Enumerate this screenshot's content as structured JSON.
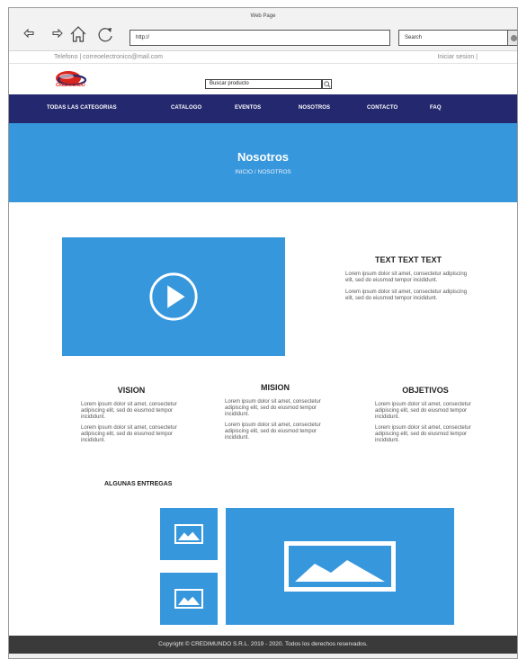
{
  "browser": {
    "window_title": "Web Page",
    "address": "http://",
    "search_placeholder": "Search"
  },
  "topbar": {
    "contact": "Telefono | correoelectronico@mail.com",
    "login": "Iniciar sesion |"
  },
  "logo": {
    "text": "CREDIMUNDO"
  },
  "product_search": {
    "placeholder": "Buscar producto"
  },
  "nav": {
    "items": [
      {
        "label": "TODAS LAS CATEGORIAS"
      },
      {
        "label": "CATALOGO"
      },
      {
        "label": "EVENTOS"
      },
      {
        "label": "NOSOTROS"
      },
      {
        "label": "CONTACTO"
      },
      {
        "label": "FAQ"
      }
    ]
  },
  "hero": {
    "title": "Nosotros",
    "breadcrumb": "INICIO / NOSOTROS"
  },
  "intro": {
    "heading": "TEXT TEXT TEXT",
    "paragraphs": [
      "Lorem ipsum dolor sit amet, consectetur adipiscing elit, sed do eiusmod tempor incididunt.",
      "Lorem ipsum dolor sit amet, consectetur adipiscing elit, sed do eiusmod tempor incididunt."
    ]
  },
  "columns": [
    {
      "title": "VISION",
      "paragraphs": [
        "Lorem ipsum dolor sit amet, consectetur adipiscing elit, sed do eiusmod tempor incididunt.",
        "Lorem ipsum dolor sit amet, consectetur adipiscing elit, sed do eiusmod tempor incididunt."
      ]
    },
    {
      "title": "MISION",
      "paragraphs": [
        "Lorem ipsum dolor sit amet, consectetur adipiscing elit, sed do eiusmod tempor incididunt.",
        "Lorem ipsum dolor sit amet, consectetur adipiscing elit, sed do eiusmod tempor incididunt."
      ]
    },
    {
      "title": "OBJETIVOS",
      "paragraphs": [
        "Lorem ipsum dolor sit amet, consectetur adipiscing elit, sed do eiusmod tempor incididunt.",
        "Lorem ipsum dolor sit amet, consectetur adipiscing elit, sed do eiusmod tempor incididunt."
      ]
    }
  ],
  "gallery": {
    "title": "ALGUNAS ENTREGAS"
  },
  "footer": {
    "copyright": "Copyright © CREDIMUNDO S.R.L. 2019 - 2020. Todos los derechos reservados."
  },
  "colors": {
    "nav_bg": "#24286e",
    "accent_blue": "#3797dd",
    "footer_bg": "#3a3a3a",
    "logo_red": "#d9261c"
  },
  "icons": [
    "back-arrow-icon",
    "forward-arrow-icon",
    "home-icon",
    "reload-icon",
    "search-magnifier-icon",
    "play-icon",
    "image-placeholder-icon"
  ]
}
